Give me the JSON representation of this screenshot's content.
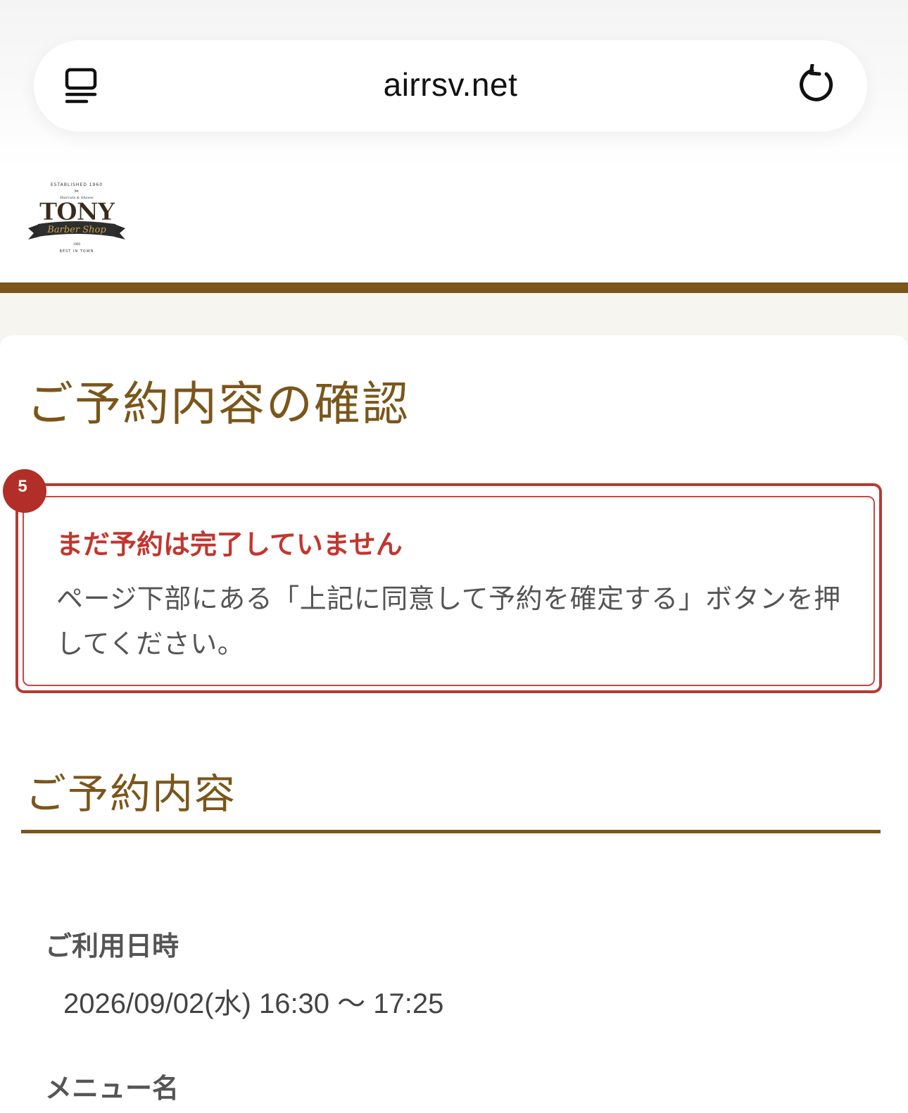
{
  "browser": {
    "url": "airrsv.net",
    "tabs_icon": "tabs-overview-icon",
    "reload_icon": "reload-icon"
  },
  "shop": {
    "logo": {
      "name": "TONY",
      "tagline": "Barber Shop",
      "top_text": "ESTABLISHED 1960",
      "sub_text": "Haircuts & Shaves",
      "bottom_text": "BEST IN TOWN",
      "number": "1960"
    }
  },
  "page": {
    "title": "ご予約内容の確認"
  },
  "alert": {
    "step_number": "5",
    "title": "まだ予約は完了していません",
    "body": "ページ下部にある「上記に同意して予約を確定する」ボタンを押してください。"
  },
  "reservation": {
    "section_title": "ご予約内容",
    "datetime_label": "ご利用日時",
    "datetime_value": "2026/09/02(水) 16:30 〜 17:25",
    "menu_label": "メニュー名"
  },
  "colors": {
    "brand_brown": "#7b561a",
    "alert_red": "#c2362e",
    "badge_red": "#b12f28"
  }
}
